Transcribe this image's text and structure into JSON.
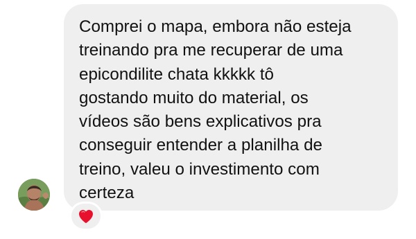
{
  "conversation": {
    "message": {
      "text": "Comprei o mapa, embora não esteja\ntreinando pra me recuperar de uma\nepicondilite chata kkkkk tô\ngostando muito do material, os\nvídeos são bens explicativos pra\nconseguir entender a planilha de\ntreino, valeu o investimento com\ncerteza",
      "bubble_color": "#efefef",
      "text_color": "#111111"
    },
    "sender": {
      "avatar_icon": "profile-photo-icon"
    },
    "reaction": {
      "icon": "heart-icon",
      "color": "#e8112d"
    }
  }
}
